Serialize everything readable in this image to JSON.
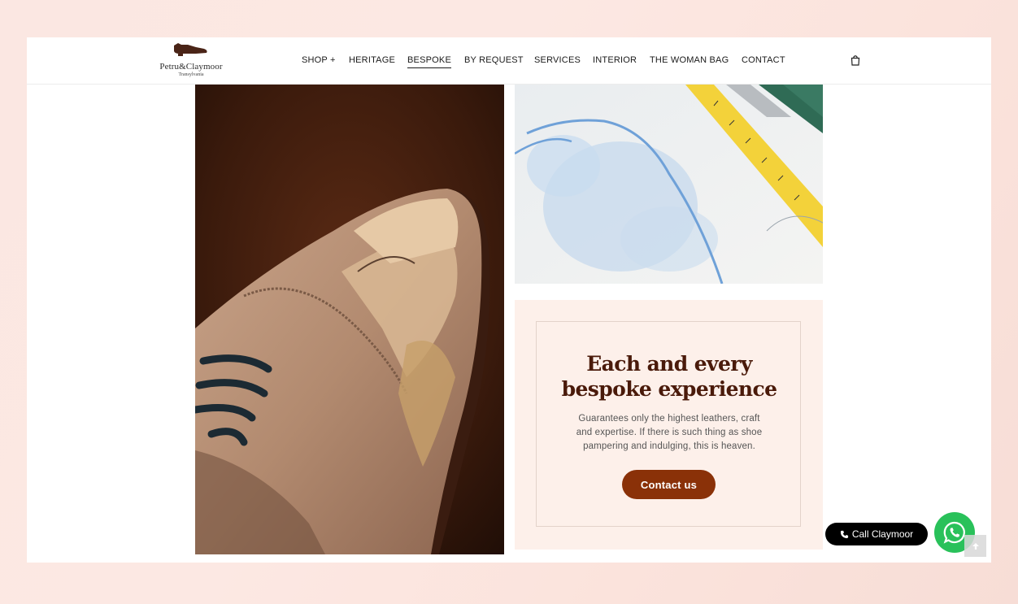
{
  "brand": {
    "name": "Petru&Claymoor",
    "subtitle": "Transylvania"
  },
  "nav": {
    "items": [
      {
        "label": "SHOP +"
      },
      {
        "label": "HERITAGE"
      },
      {
        "label": "BESPOKE"
      },
      {
        "label": "BY REQUEST"
      },
      {
        "label": "SERVICES"
      },
      {
        "label": "INTERIOR"
      },
      {
        "label": "THE WOMAN BAG"
      },
      {
        "label": "CONTACT"
      }
    ],
    "active": "BESPOKE",
    "cart_icon": "shopping-bag-icon"
  },
  "card": {
    "title_line1": "Each and every",
    "title_line2": "bespoke experience",
    "text_line1": "Guarantees only the highest leathers, craft",
    "text_line2": "and expertise. If there is such thing as shoe",
    "text_line3": "pampering and indulging, this is heaven.",
    "button": "Contact us"
  },
  "floating": {
    "call_label": "Call Claymoor",
    "call_icon": "phone-icon",
    "whatsapp_icon": "whatsapp-icon",
    "top_icon": "arrow-up-icon"
  },
  "colors": {
    "accent": "#8a3108",
    "title": "#4a1a0a",
    "card_bg": "#fdf0ea",
    "whatsapp": "#29c15a"
  }
}
